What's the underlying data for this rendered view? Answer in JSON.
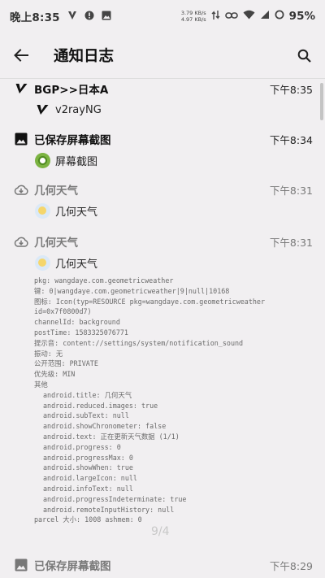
{
  "status_bar": {
    "time": "晚上8:35",
    "speed_up": "3.79 KB/s",
    "speed_down": "4.97 KB/s",
    "battery": "95%"
  },
  "app_bar": {
    "title": "通知日志"
  },
  "entries": [
    {
      "app": "BGP>>日本A",
      "time": "下午8:35",
      "sub": "v2rayNG",
      "icon": "v2ray-icon",
      "sub_icon": "v2ray-icon"
    },
    {
      "app": "已保存屏幕截图",
      "time": "下午8:34",
      "sub": "屏幕截图",
      "icon": "image-icon",
      "sub_icon": "screenshot-app-icon"
    },
    {
      "app": "几何天气",
      "time": "下午8:31",
      "sub": "几何天气",
      "icon": "cloud-download-icon",
      "sub_icon": "weather-app-icon"
    },
    {
      "app": "几何天气",
      "time": "下午8:31",
      "sub": "几何天气",
      "icon": "cloud-download-icon",
      "sub_icon": "weather-app-icon"
    },
    {
      "app": "已保存屏幕截图",
      "time": "下午8:29",
      "icon": "image-icon"
    }
  ],
  "details": [
    "pkg: wangdaye.com.geometricweather",
    "键: 0|wangdaye.com.geometricweather|9|null|10168",
    "图标: Icon(typ=RESOURCE pkg=wangdaye.com.geometricweather",
    "id=0x7f0800d7)",
    "channelId: background",
    "postTime: 1583325076771",
    "提示音: content://settings/system/notification_sound",
    "振动: 无",
    "公开范围: PRIVATE",
    "优先级: MIN",
    "其他",
    "android.title: 几何天气",
    "android.reduced.images: true",
    "android.subText: null",
    "android.showChronometer: false",
    "android.text: 正在更新天气数据 (1/1)",
    "android.progress: 0",
    "android.progressMax: 0",
    "android.showWhen: true",
    "android.largeIcon: null",
    "android.infoText: null",
    "android.progressIndeterminate: true",
    "android.remoteInputHistory: null",
    "parcel 大小: 1008 ashmem: 0"
  ],
  "pager": "9/4",
  "colors": {
    "background": "#f1eff1",
    "text": "#222222",
    "muted": "#7a7a7a"
  }
}
